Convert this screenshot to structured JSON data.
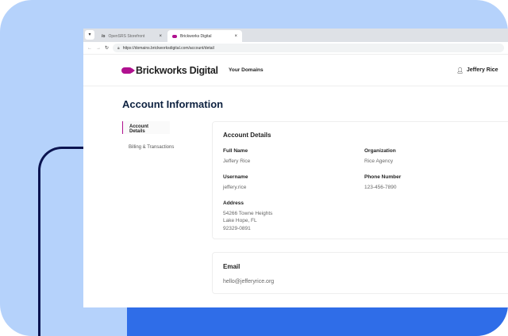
{
  "browser": {
    "tabs": [
      {
        "label": "OpenSRS Storefront",
        "icon": "/o"
      },
      {
        "label": "Brickworks Digital"
      }
    ],
    "url": "https://domains.brickworksdigital.com/account/detail"
  },
  "header": {
    "brand": "Brickworks Digital",
    "nav": "Your Domains",
    "user": "Jeffery Rice"
  },
  "page": {
    "title": "Account Information"
  },
  "sidebar": {
    "items": [
      {
        "label": "Account Details"
      },
      {
        "label": "Billing & Transactions"
      }
    ]
  },
  "details": {
    "title": "Account Details",
    "full_name_label": "Full Name",
    "full_name": "Jeffery Rice",
    "org_label": "Organization",
    "org": "Rice Agency",
    "username_label": "Username",
    "username": "jeffery.rice",
    "phone_label": "Phone Number",
    "phone": "123-456-7890",
    "address_label": "Address",
    "address": [
      "54266 Towne Heights",
      "Lake Hope, FL",
      "92329-0891"
    ]
  },
  "email": {
    "title": "Email",
    "value": "hello@jefferyrice.org"
  },
  "colors": {
    "brand": "#b0108f",
    "background": "#b5d2fb",
    "accent_blue": "#2f6de8"
  }
}
